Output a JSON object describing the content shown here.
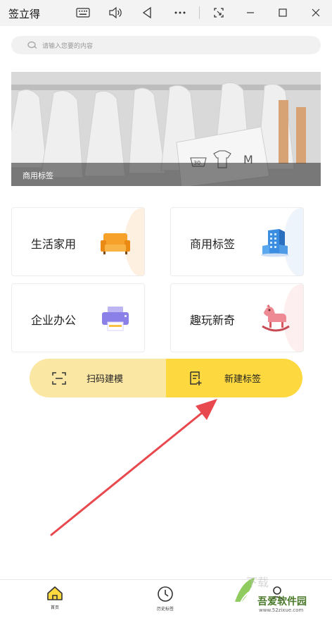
{
  "window": {
    "title": "签立得"
  },
  "search": {
    "placeholder": "请输入您要的内容"
  },
  "banner": {
    "caption": "商用标签",
    "art_text": "M",
    "wash_number": "30"
  },
  "categories": [
    {
      "label": "生活家用",
      "icon": "sofa-icon",
      "accent": "#f79a22"
    },
    {
      "label": "商用标签",
      "icon": "building-icon",
      "accent": "#3a8de0"
    },
    {
      "label": "企业办公",
      "icon": "printer-icon",
      "accent": "#8b7fe8"
    },
    {
      "label": "趣玩新奇",
      "icon": "rocking-horse-icon",
      "accent": "#e9707a"
    }
  ],
  "actions": {
    "scan_label": "扫码建模",
    "create_label": "新建标签"
  },
  "bottom_nav": {
    "items": [
      {
        "label": "首页",
        "icon": "home-icon"
      },
      {
        "label": "历史标签",
        "icon": "clock-icon"
      }
    ]
  },
  "watermark": {
    "text": "吾爱软件园",
    "url": "www.52zixue.com"
  },
  "colors": {
    "accent_yellow": "#fdd93f",
    "light_yellow": "#fbe7a4",
    "arrow_red": "#e8494e"
  }
}
